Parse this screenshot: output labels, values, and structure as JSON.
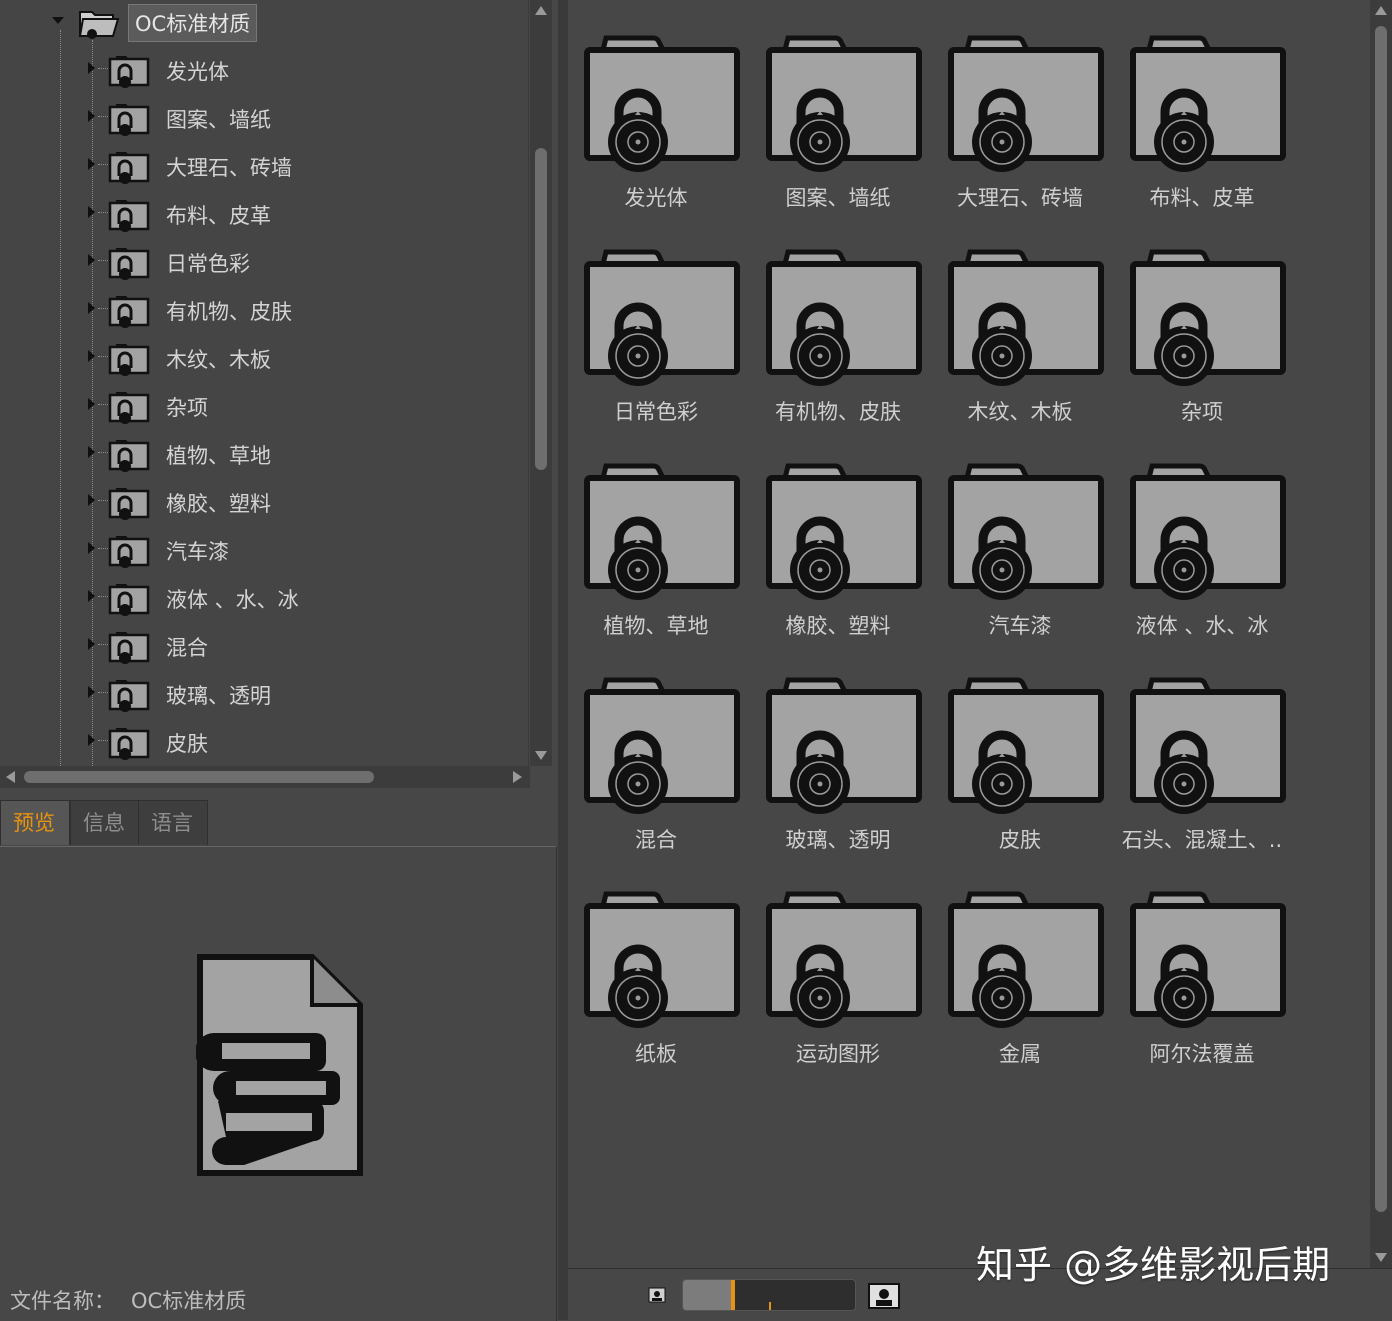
{
  "tree": {
    "root_label": "OC标准材质",
    "items": [
      "发光体",
      "图案、墙纸",
      "大理石、砖墙",
      "布料、皮革",
      "日常色彩",
      "有机物、皮肤",
      "木纹、木板",
      "杂项",
      "植物、草地",
      "橡胶、塑料",
      "汽车漆",
      "液体 、水、冰",
      "混合",
      "玻璃、透明",
      "皮肤"
    ]
  },
  "tabs": [
    {
      "label": "预览",
      "active": true
    },
    {
      "label": "信息",
      "active": false
    },
    {
      "label": "语言",
      "active": false
    }
  ],
  "preview": {
    "file_name_label": "文件名称：",
    "file_name_value": "OC标准材质",
    "icon": "books-document-icon"
  },
  "grid": {
    "items": [
      "发光体",
      "图案、墙纸",
      "大理石、砖墙",
      "布料、皮革",
      "日常色彩",
      "有机物、皮肤",
      "木纹、木板",
      "杂项",
      "植物、草地",
      "橡胶、塑料",
      "汽车漆",
      "液体 、水、冰",
      "混合",
      "玻璃、透明",
      "皮肤",
      "石头、混凝土、..",
      "纸板",
      "运动图形",
      "金属",
      "阿尔法覆盖"
    ],
    "icon": "locked-folder-icon"
  },
  "zoom": {
    "level_fraction": 0.28
  },
  "watermark": "知乎 @多维影视后期",
  "colors": {
    "accent": "#e8930f",
    "background": "#474747",
    "folder_fill": "#a3a3a3",
    "folder_outline": "#111111"
  }
}
